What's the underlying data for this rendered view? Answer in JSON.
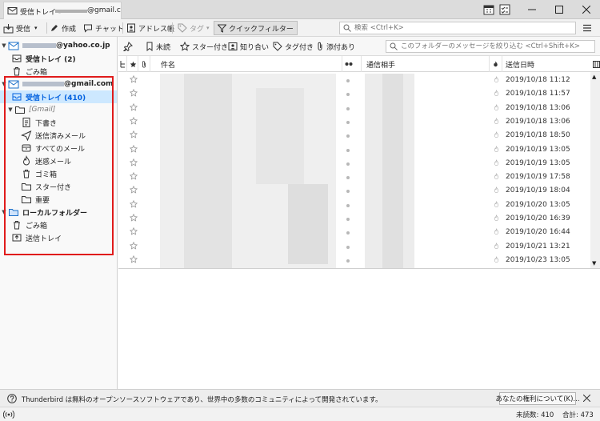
{
  "window": {
    "tab_title": "受信トレイ -",
    "tab_title_suffix": "@gmail.c"
  },
  "toolbar": {
    "get_messages": "受信",
    "write": "作成",
    "chat": "チャット",
    "address_book": "アドレス帳",
    "tag": "タグ",
    "quick_filter": "クイックフィルター",
    "search_placeholder": "検索 <Ctrl+K>"
  },
  "sidebar": {
    "yahoo_account": "@yahoo.co.jp",
    "yahoo_folders": [
      {
        "label": "受信トレイ (2)",
        "icon": "inbox-icon"
      },
      {
        "label": "ごみ箱",
        "icon": "trash-icon"
      }
    ],
    "gmail_account": "@gmail.com",
    "gmail_inbox": "受信トレイ (410)",
    "gmail_group": "[Gmail]",
    "gmail_subfolders": [
      {
        "label": "下書き",
        "icon": "drafts-icon"
      },
      {
        "label": "送信済みメール",
        "icon": "sent-icon"
      },
      {
        "label": "すべてのメール",
        "icon": "archive-icon"
      },
      {
        "label": "迷惑メール",
        "icon": "junk-icon"
      },
      {
        "label": "ゴミ箱",
        "icon": "trash-icon"
      },
      {
        "label": "スター付き",
        "icon": "folder-icon"
      },
      {
        "label": "重要",
        "icon": "folder-icon"
      }
    ],
    "local_folders": "ローカルフォルダー",
    "local_subfolders": [
      {
        "label": "ごみ箱",
        "icon": "trash-icon"
      },
      {
        "label": "送信トレイ",
        "icon": "outbox-icon"
      }
    ]
  },
  "filterbar": {
    "unread": "未読",
    "starred": "スター付き",
    "contacts": "知り合い",
    "tagged": "タグ付き",
    "attachment": "添付あり",
    "filter_placeholder": "このフォルダーのメッセージを絞り込む <Ctrl+Shift+K>"
  },
  "threads": {
    "columns": {
      "subject": "件名",
      "correspondents": "通信相手",
      "date": "送信日時"
    },
    "dates": [
      "2019/10/18 11:12",
      "2019/10/18 11:57",
      "2019/10/18 13:06",
      "2019/10/18 13:06",
      "2019/10/18 18:50",
      "2019/10/19 13:05",
      "2019/10/19 13:05",
      "2019/10/19 17:58",
      "2019/10/19 18:04",
      "2019/10/20 13:05",
      "2019/10/20 16:39",
      "2019/10/20 16:44",
      "2019/10/21 13:21",
      "2019/10/23 13:05"
    ]
  },
  "notification": {
    "text": "Thunderbird は無料のオープンソースソフトウェアであり、世界中の多数のコミュニティによって開発されています。",
    "rights_button": "あなたの権利について(K)..."
  },
  "status": {
    "unread": "未読数: 410",
    "total": "合計: 473"
  },
  "colors": {
    "selection": "#cde8ff",
    "accent": "#0060df",
    "highlight_box": "#e01b1b"
  }
}
